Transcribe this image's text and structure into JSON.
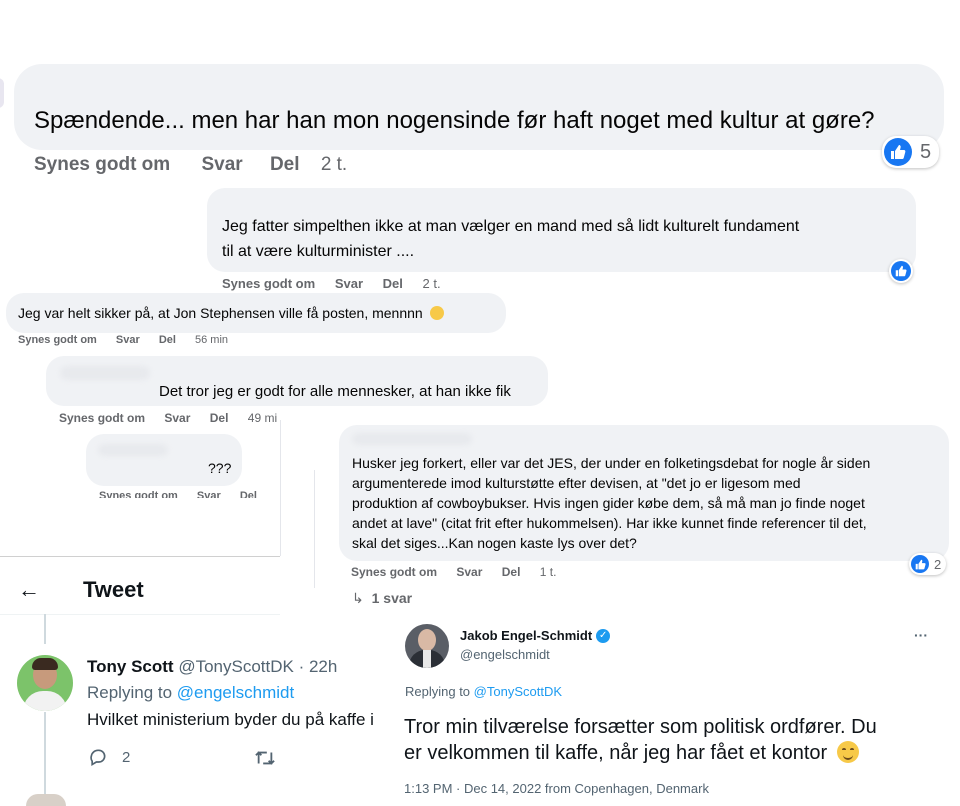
{
  "colors": {
    "fb_bubble": "#f0f2f5",
    "fb_blue": "#1877f2",
    "fb_gray": "#65676b",
    "tw_blue": "#1d9bf0",
    "tw_gray": "#536471"
  },
  "comments": [
    {
      "text": "Spændende... men har han mon nogensinde før haft noget med kultur at gøre?",
      "like": "Synes godt om",
      "reply": "Svar",
      "share": "Del",
      "time": "2 t.",
      "reactions": "5"
    },
    {
      "text_line1": "Jeg fatter simpelthen ikke at man vælger en mand med så lidt kulturelt fundament",
      "text_line2": "til at være kulturminister ....",
      "like": "Synes godt om",
      "reply": "Svar",
      "share": "Del",
      "time": "2 t."
    },
    {
      "text": "Jeg var helt sikker på, at Jon Stephensen ville få posten, mennnn",
      "like": "Synes godt om",
      "reply": "Svar",
      "share": "Del",
      "time": "56 min"
    },
    {
      "text": "Det tror jeg er godt for alle mennesker, at han ikke fik",
      "like": "Synes godt om",
      "reply": "Svar",
      "share": "Del",
      "time": "49 mi"
    },
    {
      "text": "???",
      "like": "Synes godt om",
      "reply": "Svar",
      "share": "Del"
    },
    {
      "lines": [
        "Husker jeg forkert, eller var det JES, der under en folketingsdebat for nogle år siden",
        "argumenterede imod kulturstøtte efter devisen, at \"det jo er ligesom med",
        "produktion af cowboybukser. Hvis ingen gider købe dem, så må man jo finde noget",
        "andet at lave\" (citat frit efter hukommelsen). Har ikke kunnet finde referencer til det,",
        "skal det siges...Kan nogen kaste lys over det?"
      ],
      "like": "Synes godt om",
      "reply": "Svar",
      "share": "Del",
      "time": "1 t.",
      "reactions": "2",
      "replies": "1 svar"
    }
  ],
  "tweet_page": {
    "title": "Tweet",
    "tweet": {
      "name": "Tony Scott",
      "handle": "@TonyScottDK",
      "time": "· 22h",
      "replying_prefix": "Replying to ",
      "replying_to": "@engelschmidt",
      "text": "Hvilket ministerium byder du på kaffe i",
      "reply_count": "2"
    },
    "reply": {
      "name": "Jakob Engel-Schmidt",
      "handle": "@engelschmidt",
      "more": "···",
      "replying_prefix": "Replying to ",
      "replying_to": "@TonyScottDK",
      "text_line1": "Tror min tilværelse forsætter som politisk ordfører. Du",
      "text_line2": "er velkommen til kaffe, når jeg har fået et kontor",
      "meta": "1:13 PM · Dec 14, 2022 from Copenhagen, Denmark"
    }
  }
}
